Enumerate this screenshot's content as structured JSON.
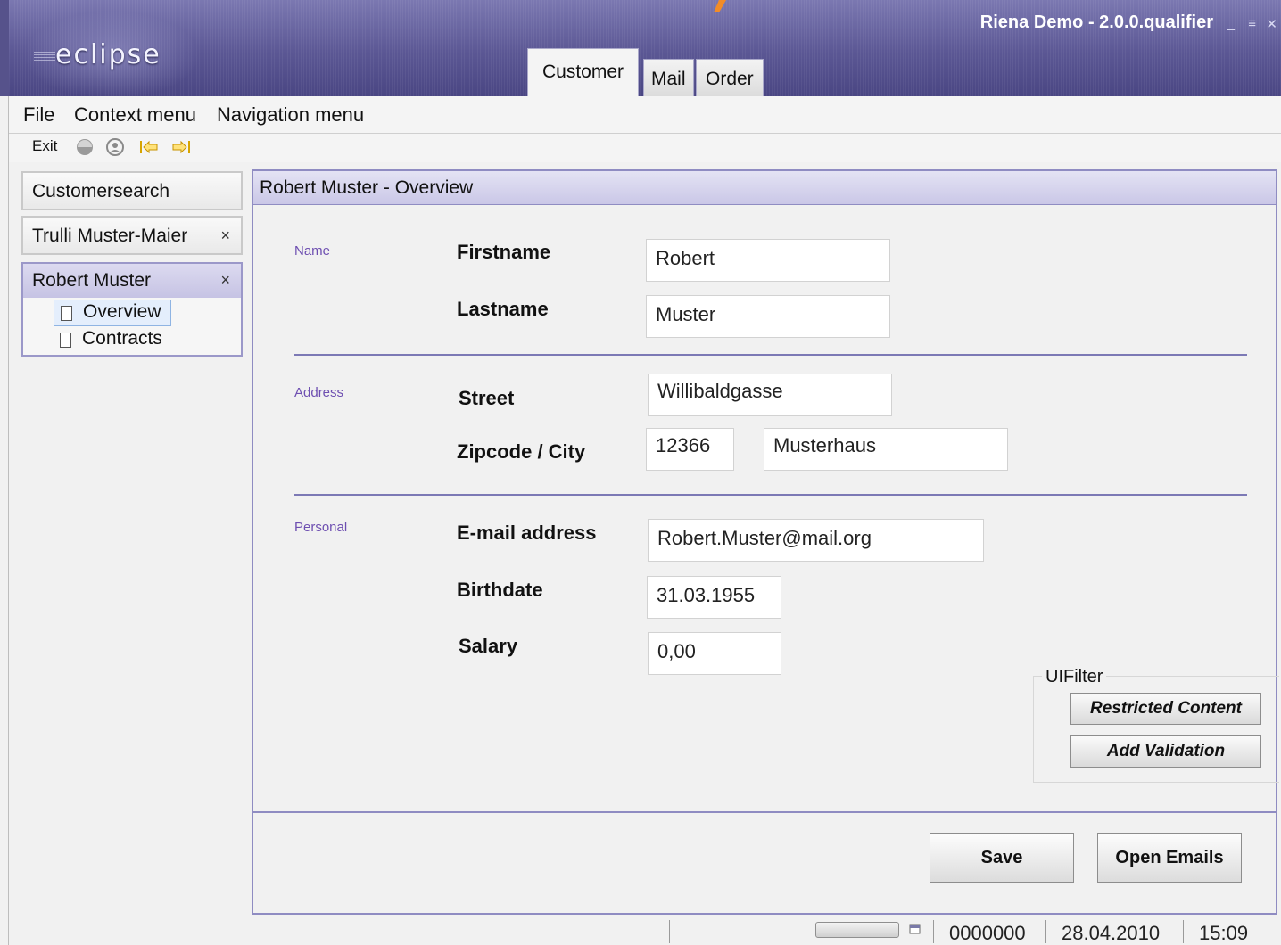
{
  "window": {
    "title": "Riena Demo - 2.0.0.qualifier",
    "logo_text": "eclipse",
    "controls": [
      "_",
      "≡",
      "✕"
    ],
    "accent_color": "#f28c28"
  },
  "module_tabs": [
    {
      "label": "Customer",
      "active": true
    },
    {
      "label": "Mail",
      "active": false
    },
    {
      "label": "Order",
      "active": false
    }
  ],
  "menu": [
    "File",
    "Context menu",
    "Navigation menu"
  ],
  "toolbar": {
    "exit_label": "Exit",
    "icons": [
      "sphere-icon",
      "user-icon",
      "back-arrow-icon",
      "forward-arrow-icon"
    ]
  },
  "navigation": {
    "items": [
      {
        "label": "Customersearch",
        "closable": false
      },
      {
        "label": "Trulli Muster-Maier",
        "closable": true,
        "close_glyph": "×"
      }
    ],
    "expanded": {
      "label": "Robert Muster",
      "close_glyph": "×",
      "children": [
        {
          "label": "Overview",
          "selected": true
        },
        {
          "label": "Contracts",
          "selected": false
        }
      ]
    }
  },
  "main": {
    "title": "Robert Muster - Overview",
    "groups": {
      "name": "Name",
      "address": "Address",
      "personal": "Personal"
    },
    "labels": {
      "firstname": "Firstname",
      "lastname": "Lastname",
      "street": "Street",
      "zip_city": "Zipcode / City",
      "email": "E-mail address",
      "birthdate": "Birthdate",
      "salary": "Salary"
    },
    "values": {
      "firstname": "Robert",
      "lastname": "Muster",
      "street": "Willibaldgasse",
      "zipcode": "12366",
      "city": "Musterhaus",
      "email": "Robert.Muster@mail.org",
      "birthdate": "31.03.1955",
      "salary": "0,00"
    },
    "uifilter": {
      "title": "UIFilter",
      "buttons": [
        "Restricted Content",
        "Add Validation"
      ]
    },
    "actions": {
      "save": "Save",
      "open_emails": "Open Emails"
    }
  },
  "status": {
    "number": "0000000",
    "date": "28.04.2010",
    "time": "15:09"
  }
}
